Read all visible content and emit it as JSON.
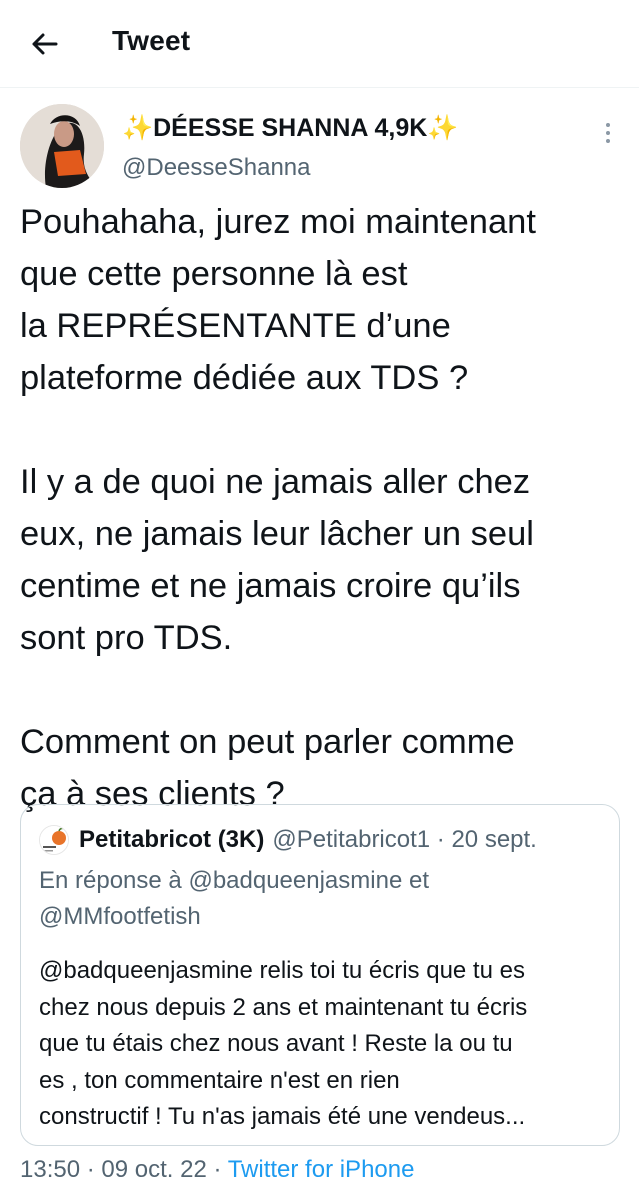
{
  "header": {
    "title": "Tweet",
    "back_icon": "arrow-left-icon"
  },
  "author": {
    "display_name": "✨DÉESSE SHANNA 4,9K✨",
    "handle": "@DeesseShanna"
  },
  "tweet": {
    "paragraphs": [
      "Pouhahaha, jurez moi maintenant\nque cette personne là est\nla REPRÉSENTANTE d’une\nplateforme dédiée aux TDS ?",
      "Il y a de quoi ne jamais aller chez\neux, ne jamais leur lâcher un seul\ncentime et ne jamais croire qu’ils\nsont pro TDS.",
      "Comment on peut parler comme\nça à ses clients ?"
    ]
  },
  "quote": {
    "name": "Petitabricot (3K)",
    "handle_time": "@Petitabricot1 · 20 sept.",
    "reply_prefix": "En réponse à",
    "reply_to_1": "@badqueenjasmine",
    "reply_and": "et",
    "reply_to_2": "@MMfootfetish",
    "text": "@badqueenjasmine relis toi tu écris que tu es\nchez nous depuis 2 ans et maintenant tu écris\nque tu étais chez  nous avant ! Reste la ou tu\nes , ton commentaire n'est en rien\nconstructif ! Tu n'as jamais été une vendeus..."
  },
  "meta": {
    "time_date": "13:50 · 09 oct. 22 ·",
    "source": "Twitter for iPhone"
  },
  "colors": {
    "link": "#1d9bf0",
    "secondary_text": "#536471",
    "border": "#cfd9de"
  }
}
